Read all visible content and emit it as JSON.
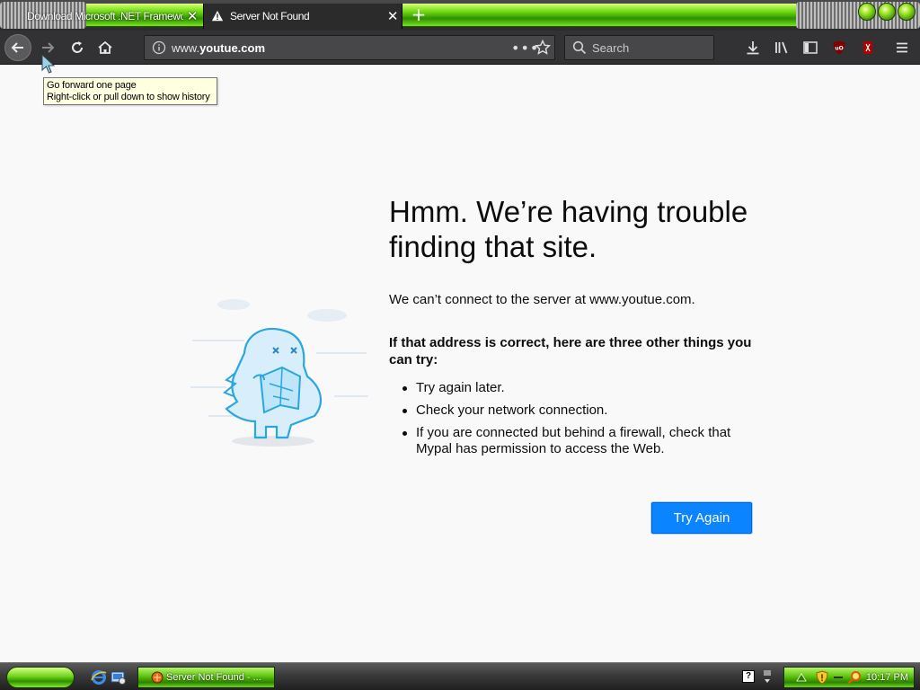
{
  "window": {
    "tabs": [
      {
        "label": "Download Microsoft .NET Framework",
        "active": false
      },
      {
        "label": "Server Not Found",
        "active": true
      }
    ]
  },
  "toolbar": {
    "url": "www.youtue.com",
    "url_host": "youtue.com",
    "url_prefix": "www.",
    "search_placeholder": "Search",
    "more_actions": "•••"
  },
  "tooltip": {
    "line1": "Go forward one page",
    "line2": "Right-click or pull down to show history"
  },
  "error_page": {
    "title_line1": "Hmm. We’re having trouble",
    "title_line2": "finding that site.",
    "description": "We can’t connect to the server at www.youtue.com.",
    "try_heading": "If that address is correct, here are three other things you can try:",
    "suggestions": [
      "Try again later.",
      "Check your network connection.",
      "If you are connected but behind a firewall, check that Mypal has permission to access the Web."
    ],
    "try_again_label": "Try Again"
  },
  "taskbar": {
    "task_label": "Server Not Found - ...",
    "clock": "10:17 PM",
    "help_glyph": "?"
  },
  "colors": {
    "accent": "#0a84ff",
    "theme_green": "#5cc30c",
    "toolbar_bg": "#323234",
    "page_bg": "#f9f9fa"
  }
}
